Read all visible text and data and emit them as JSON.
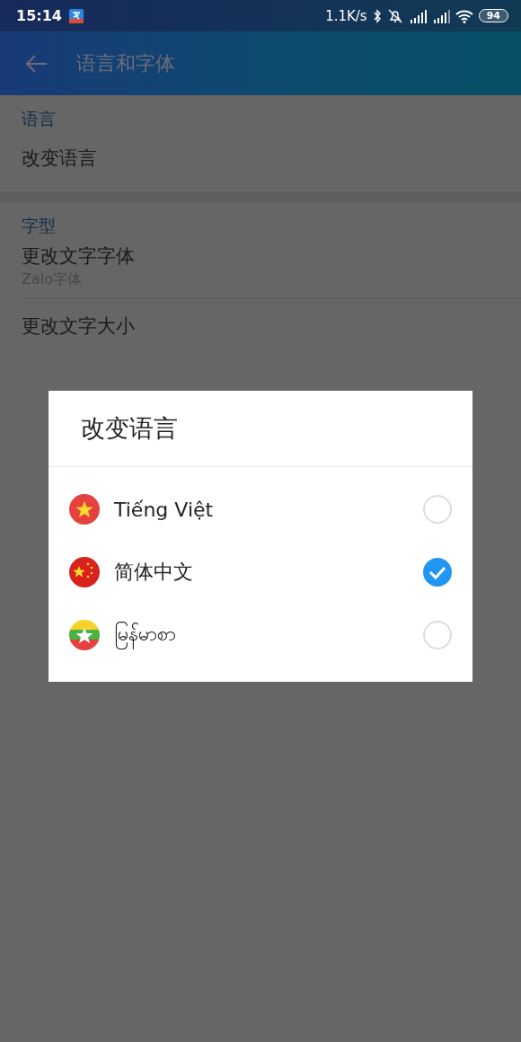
{
  "status_bar": {
    "time": "15:14",
    "speed": "1.1K/s",
    "battery": "94"
  },
  "app_bar": {
    "title": "语言和字体"
  },
  "sections": [
    {
      "header": "语言",
      "items": [
        {
          "title": "改变语言"
        }
      ]
    },
    {
      "header": "字型",
      "items": [
        {
          "title": "更改文字字体",
          "subtitle": "Zalo字体"
        },
        {
          "title": "更改文字大小"
        }
      ]
    }
  ],
  "dialog": {
    "title": "改变语言",
    "options": [
      {
        "label": "Tiếng Việt",
        "kind": "vn",
        "selected": false
      },
      {
        "label": "简体中文",
        "kind": "cn",
        "selected": true
      },
      {
        "label": "မြန်မာစာ",
        "kind": "mm",
        "selected": false
      }
    ]
  }
}
